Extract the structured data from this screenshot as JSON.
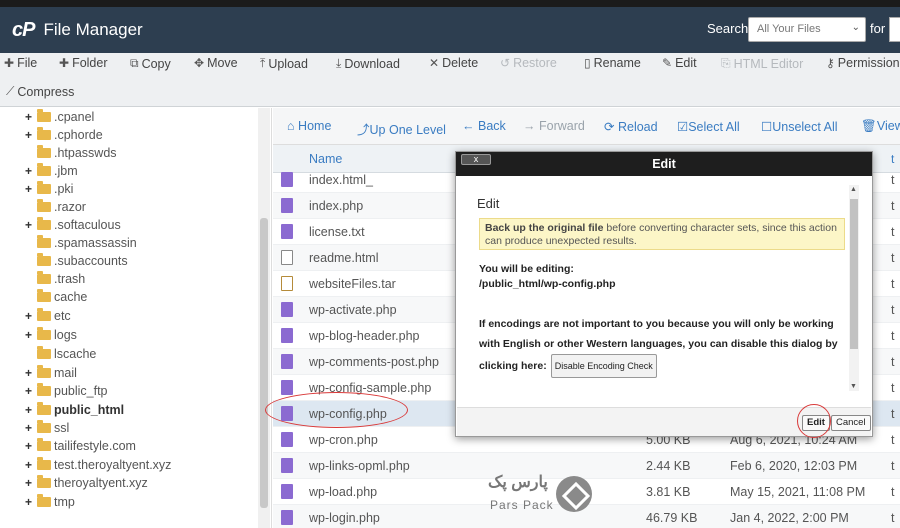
{
  "header": {
    "logo_mark": "cP",
    "app_title": "File Manager",
    "search_label": "Search",
    "search_scope": "All Your Files",
    "for_label": "for"
  },
  "toolbar": {
    "row1": [
      {
        "icon": "plus-icon",
        "label": "File",
        "enabled": true
      },
      {
        "icon": "plus-icon",
        "label": "Folder",
        "enabled": true
      },
      {
        "icon": "copy-icon",
        "label": "Copy",
        "enabled": true
      },
      {
        "icon": "move-icon",
        "label": "Move",
        "enabled": true
      },
      {
        "icon": "upload-icon",
        "label": "Upload",
        "enabled": true
      },
      {
        "icon": "download-icon",
        "label": "Download",
        "enabled": true
      },
      {
        "icon": "delete-icon",
        "label": "Delete",
        "enabled": true
      },
      {
        "icon": "restore-icon",
        "label": "Restore",
        "enabled": false
      },
      {
        "icon": "rename-icon",
        "label": "Rename",
        "enabled": true
      },
      {
        "icon": "pencil-icon",
        "label": "Edit",
        "enabled": true
      },
      {
        "icon": "html-editor-icon",
        "label": "HTML Editor",
        "enabled": false
      },
      {
        "icon": "key-icon",
        "label": "Permission",
        "enabled": true
      }
    ],
    "row2": [
      {
        "icon": "compress-icon",
        "label": "Compress",
        "enabled": true
      }
    ]
  },
  "tree": [
    {
      "label": ".cpanel",
      "expandable": true,
      "indent": 1
    },
    {
      "label": ".cphorde",
      "expandable": true,
      "indent": 1
    },
    {
      "label": ".htpasswds",
      "expandable": false,
      "indent": 1
    },
    {
      "label": ".jbm",
      "expandable": true,
      "indent": 1
    },
    {
      "label": ".pki",
      "expandable": true,
      "indent": 1
    },
    {
      "label": ".razor",
      "expandable": false,
      "indent": 1
    },
    {
      "label": ".softaculous",
      "expandable": true,
      "indent": 1
    },
    {
      "label": ".spamassassin",
      "expandable": false,
      "indent": 1
    },
    {
      "label": ".subaccounts",
      "expandable": false,
      "indent": 1
    },
    {
      "label": ".trash",
      "expandable": false,
      "indent": 1
    },
    {
      "label": "cache",
      "expandable": false,
      "indent": 1
    },
    {
      "label": "etc",
      "expandable": true,
      "indent": 1
    },
    {
      "label": "logs",
      "expandable": true,
      "indent": 1
    },
    {
      "label": "lscache",
      "expandable": false,
      "indent": 1
    },
    {
      "label": "mail",
      "expandable": true,
      "indent": 1
    },
    {
      "label": "public_ftp",
      "expandable": true,
      "indent": 1
    },
    {
      "label": "public_html",
      "expandable": true,
      "indent": 1,
      "bold": true
    },
    {
      "label": "ssl",
      "expandable": true,
      "indent": 1
    },
    {
      "label": "tailifestyle.com",
      "expandable": true,
      "indent": 1
    },
    {
      "label": "test.theroyaltyent.xyz",
      "expandable": true,
      "indent": 1
    },
    {
      "label": "theroyaltyent.xyz",
      "expandable": true,
      "indent": 1
    },
    {
      "label": "tmp",
      "expandable": true,
      "indent": 1
    }
  ],
  "nav": [
    {
      "icon": "home-icon",
      "label": "Home",
      "enabled": true
    },
    {
      "icon": "up-level-icon",
      "label": "Up One Level",
      "enabled": true
    },
    {
      "icon": "back-icon",
      "label": "Back",
      "enabled": true
    },
    {
      "icon": "forward-icon",
      "label": "Forward",
      "enabled": false
    },
    {
      "icon": "reload-icon",
      "label": "Reload",
      "enabled": true
    },
    {
      "icon": "checkbox-checked-icon",
      "label": "Select All",
      "enabled": true
    },
    {
      "icon": "checkbox-empty-icon",
      "label": "Unselect All",
      "enabled": true
    },
    {
      "icon": "trash-icon",
      "label": "View",
      "enabled": true
    }
  ],
  "table": {
    "name_header": "Name",
    "rows": [
      {
        "name": "index.html_",
        "size": "",
        "date": "",
        "type": "t",
        "icon": "php"
      },
      {
        "name": "index.php",
        "size": "",
        "date": "",
        "type": "t",
        "icon": "php"
      },
      {
        "name": "license.txt",
        "size": "",
        "date": "",
        "type": "t",
        "icon": "php"
      },
      {
        "name": "readme.html",
        "size": "",
        "date": "",
        "type": "t",
        "icon": "txt"
      },
      {
        "name": "websiteFiles.tar",
        "size": "",
        "date": "",
        "type": "t",
        "icon": "tar"
      },
      {
        "name": "wp-activate.php",
        "size": "",
        "date": "",
        "type": "t",
        "icon": "php"
      },
      {
        "name": "wp-blog-header.php",
        "size": "",
        "date": "",
        "type": "t",
        "icon": "php"
      },
      {
        "name": "wp-comments-post.php",
        "size": "",
        "date": "",
        "type": "t",
        "icon": "php"
      },
      {
        "name": "wp-config-sample.php",
        "size": "",
        "date": "",
        "type": "t",
        "icon": "php"
      },
      {
        "name": "wp-config.php",
        "size": "",
        "date": "",
        "type": "t",
        "icon": "php",
        "selected": true
      },
      {
        "name": "wp-cron.php",
        "size": "5.00 KB",
        "date": "Aug 6, 2021, 10:24 AM",
        "type": "t",
        "icon": "php"
      },
      {
        "name": "wp-links-opml.php",
        "size": "2.44 KB",
        "date": "Feb 6, 2020, 12:03 PM",
        "type": "t",
        "icon": "php"
      },
      {
        "name": "wp-load.php",
        "size": "3.81 KB",
        "date": "May 15, 2021, 11:08 PM",
        "type": "t",
        "icon": "php"
      },
      {
        "name": "wp-login.php",
        "size": "46.79 KB",
        "date": "Jan 4, 2022, 2:00 PM",
        "type": "t",
        "icon": "php"
      }
    ]
  },
  "dialog": {
    "title": "Edit",
    "close_label": "x",
    "heading": "Edit",
    "warning_bold": "Back up the original file",
    "warning_rest": "before converting character sets, since this action can produce unexpected results.",
    "editing_label": "You will be editing:",
    "editing_path": "/public_html/wp-config.php",
    "encodings_text": "If encodings are not important to you because you will only be working with English or other Western languages, you can disable this dialog by clicking here:",
    "disable_button": "Disable Encoding Check",
    "edit_button": "Edit",
    "cancel_button": "Cancel"
  },
  "watermark": {
    "fa": "پارس پک",
    "en": "Pars Pack"
  },
  "colors": {
    "header_bg": "#2d3e50",
    "link_blue": "#3a7cc2",
    "annotation_red": "#d93a3a",
    "folder_yellow": "#e8b84a",
    "php_icon_purple": "#8b6ad1"
  }
}
